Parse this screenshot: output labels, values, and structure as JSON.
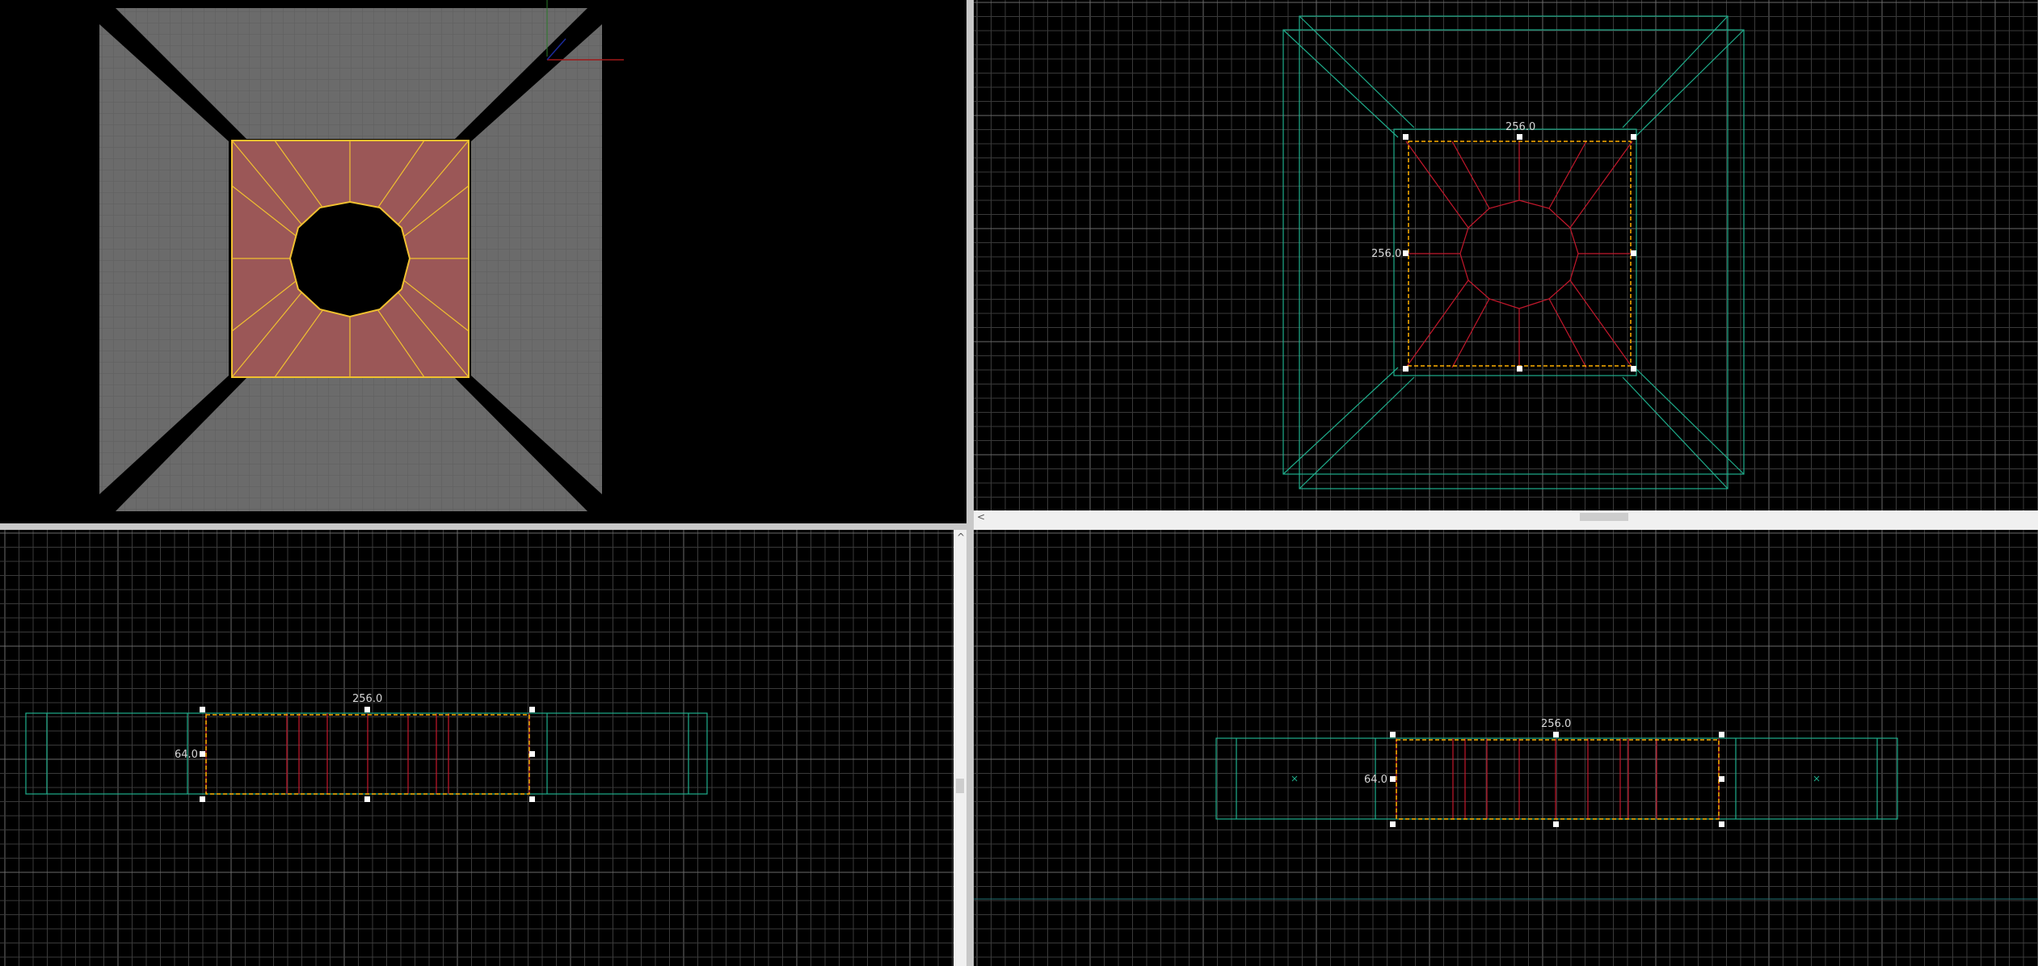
{
  "viewports": {
    "top": {
      "width_label": "256.0",
      "height_label": "256.0"
    },
    "front": {
      "width_label": "256.0",
      "height_label": "64.0"
    },
    "side": {
      "width_label": "256.0",
      "height_label": "64.0"
    }
  },
  "scroll": {
    "left_arrow": "<",
    "up_arrow": "^"
  },
  "colors": {
    "grid": "#3a3a3a",
    "grid_major": "#6a6a6a",
    "selection": "#ffb000",
    "brush_red": "#c4182c",
    "brush_teal": "#1fae8c",
    "face_fill": "#9b5757",
    "face_edge": "#f0c030",
    "wall_gray": "#6a6a6a"
  }
}
